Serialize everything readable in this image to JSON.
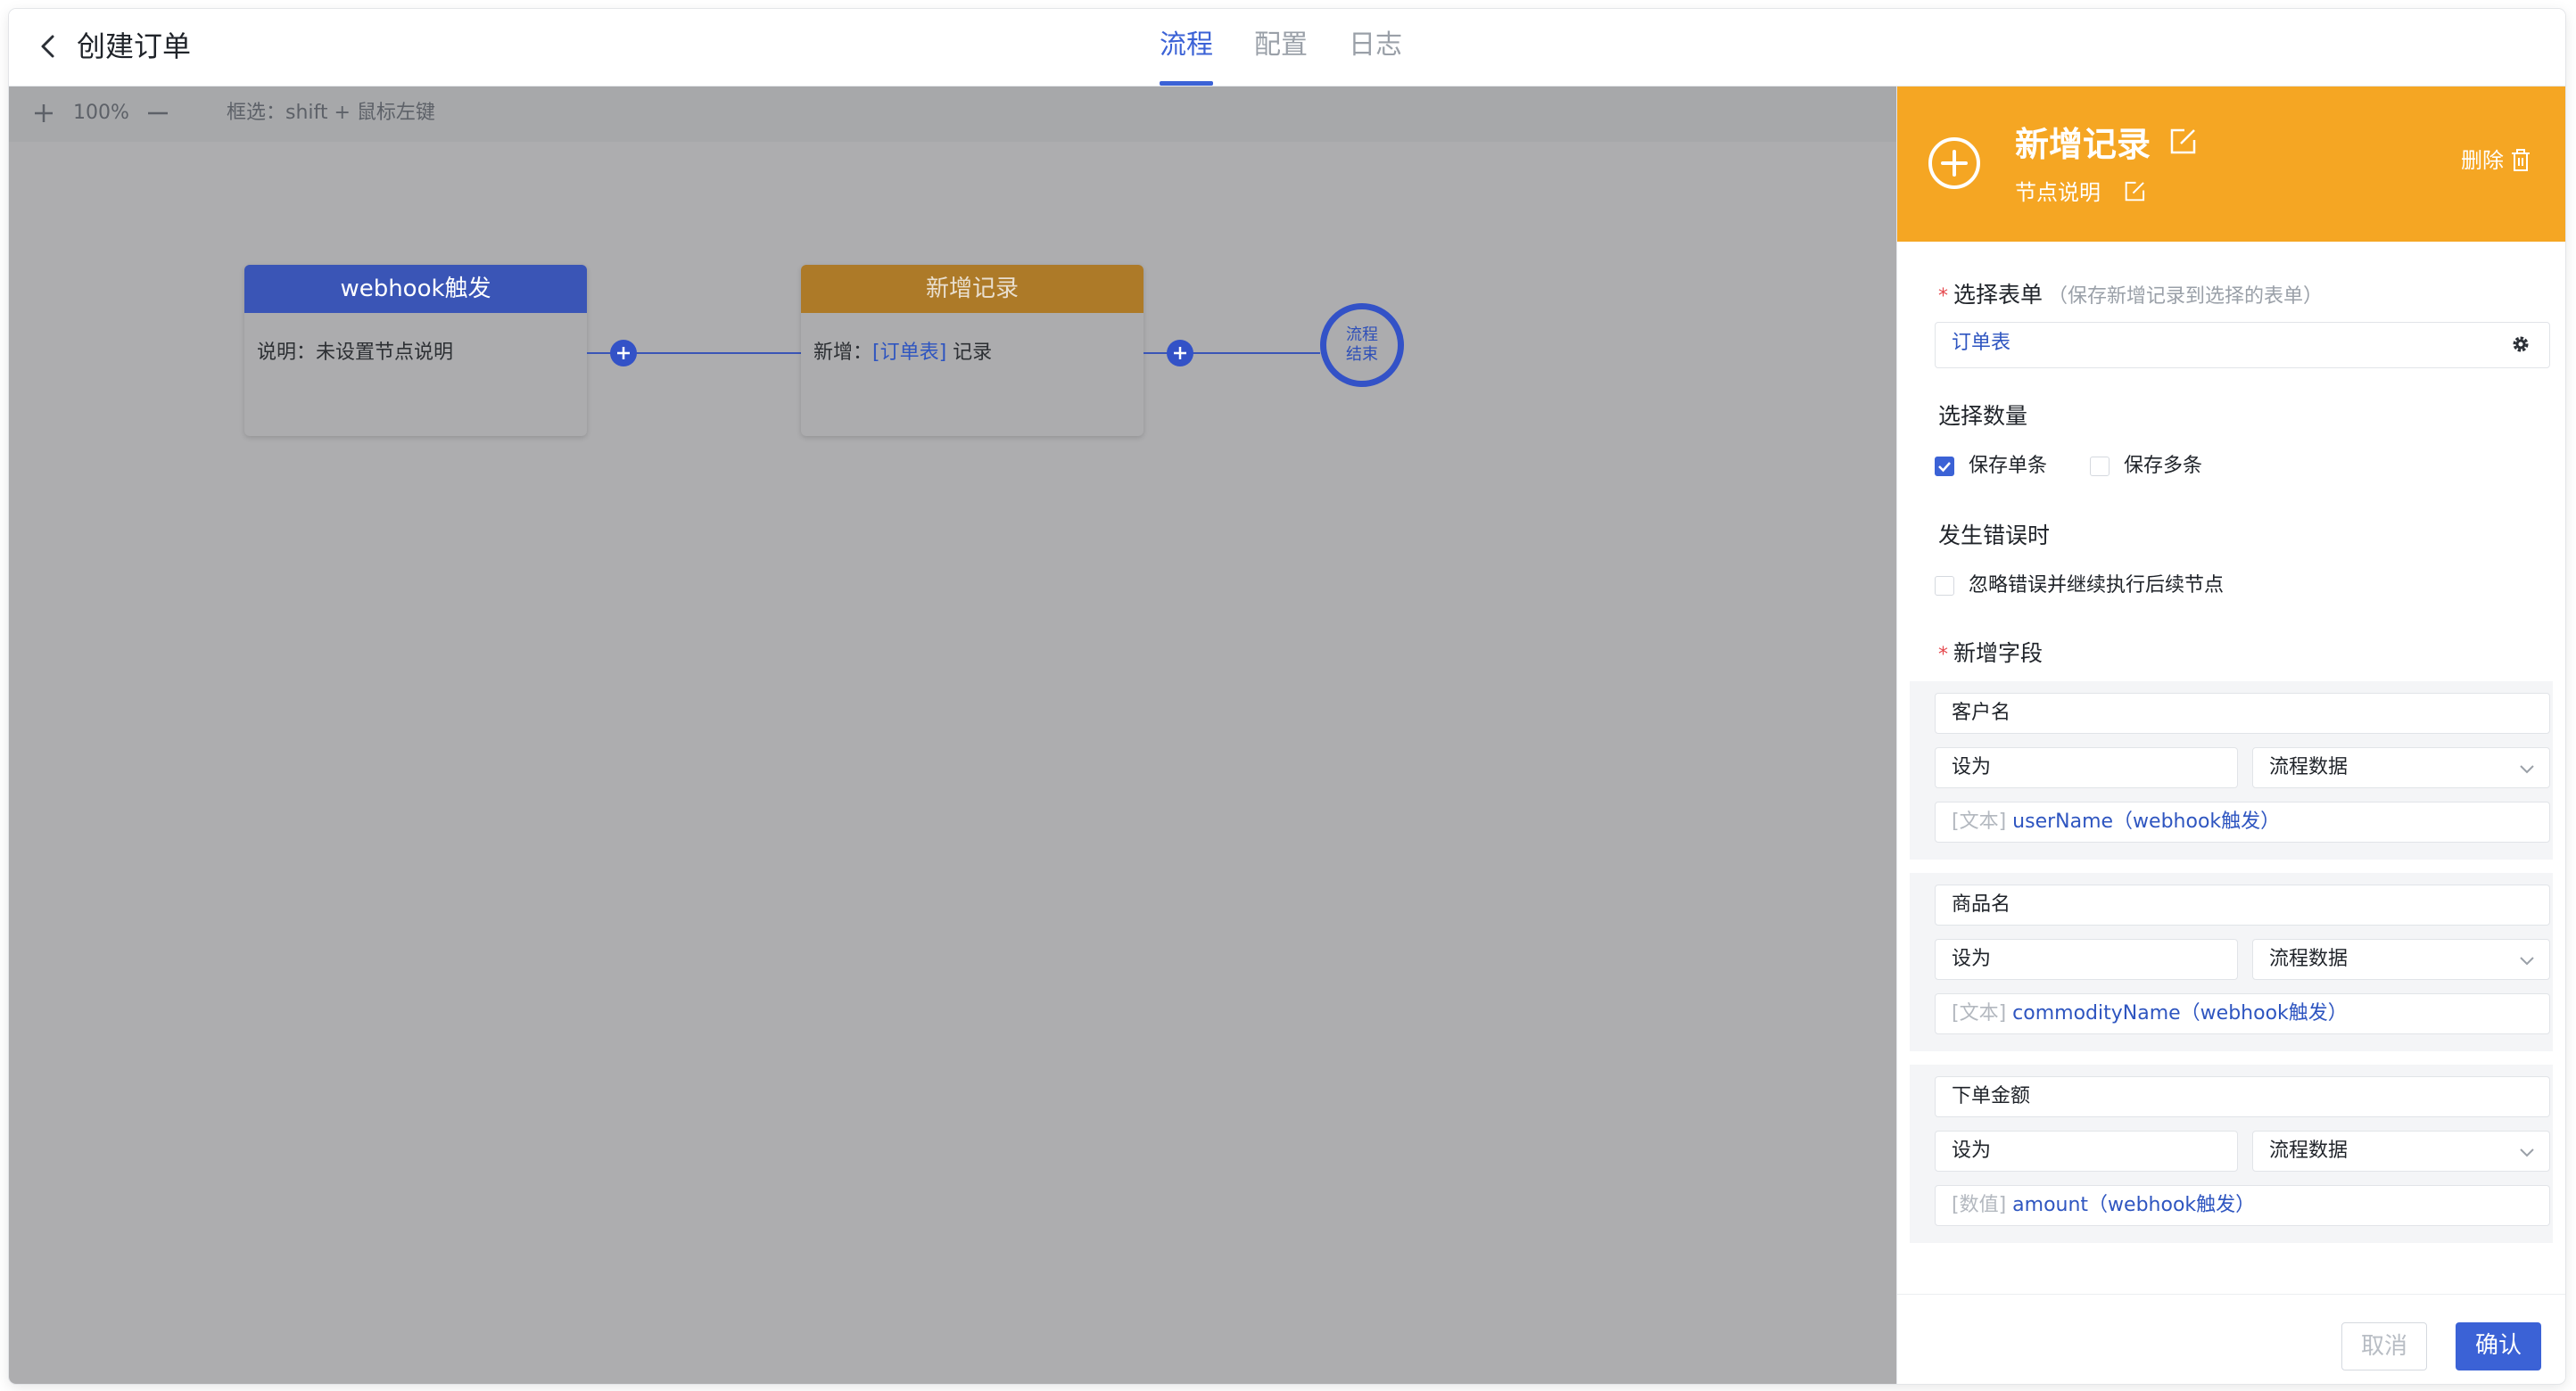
{
  "header": {
    "back_icon": "chevron-left-icon",
    "title": "创建订单",
    "tabs": [
      {
        "label": "流程",
        "active": true
      },
      {
        "label": "配置",
        "active": false
      },
      {
        "label": "日志",
        "active": false
      }
    ]
  },
  "canvas": {
    "toolbar": {
      "zoom_in_icon": "plus-icon",
      "zoom_level": "100%",
      "zoom_out_icon": "minus-icon",
      "select_hint": "框选：shift + 鼠标左键"
    },
    "nodes": [
      {
        "title": "webhook触发",
        "desc_prefix": "说明：",
        "desc": "未设置节点说明"
      },
      {
        "title": "新增记录",
        "desc_prefix": "新增：",
        "desc_link": "[订单表]",
        "desc_suffix": " 记录"
      }
    ],
    "end_node": {
      "line1": "流程",
      "line2": "结束"
    }
  },
  "panel": {
    "header": {
      "title": "新增记录",
      "subtitle": "节点说明",
      "delete_label": "删除",
      "color": "#f5a623"
    },
    "form_select": {
      "label": "选择表单",
      "hint": "（保存新增记录到选择的表单）",
      "value": "订单表"
    },
    "quantity": {
      "label": "选择数量",
      "options": [
        {
          "label": "保存单条",
          "checked": true
        },
        {
          "label": "保存多条",
          "checked": false
        }
      ]
    },
    "error": {
      "label": "发生错误时",
      "option": "忽略错误并继续执行后续节点",
      "checked": false
    },
    "fields": {
      "label": "新增字段",
      "items": [
        {
          "name": "客户名",
          "op": "设为",
          "source": "流程数据",
          "type_tag": "[文本]",
          "value": "userName（webhook触发）"
        },
        {
          "name": "商品名",
          "op": "设为",
          "source": "流程数据",
          "type_tag": "[文本]",
          "value": "commodityName（webhook触发）"
        },
        {
          "name": "下单金额",
          "op": "设为",
          "source": "流程数据",
          "type_tag": "[数值]",
          "value": "amount（webhook触发）"
        }
      ]
    },
    "footer": {
      "cancel": "取消",
      "confirm": "确认"
    }
  },
  "colors": {
    "accent": "#3b62d6",
    "trigger": "#3a55b6",
    "action": "#f5a623"
  }
}
